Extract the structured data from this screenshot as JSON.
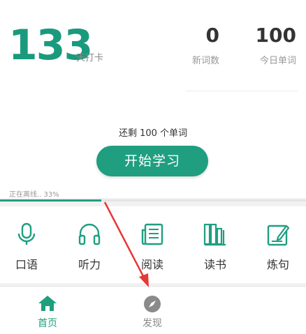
{
  "stats": {
    "days_value": "133",
    "days_label": "天打卡",
    "new_words_value": "0",
    "new_words_label": "新词数",
    "today_words_value": "100",
    "today_words_label": "今日单词"
  },
  "main": {
    "remaining_text": "还剩 100 个单词",
    "start_button": "开始学习"
  },
  "offline": {
    "status_text": "正在离线.. 33%",
    "progress": 0.33
  },
  "tools": [
    {
      "label": "口语",
      "icon": "microphone-icon"
    },
    {
      "label": "听力",
      "icon": "headphones-icon"
    },
    {
      "label": "阅读",
      "icon": "newspaper-icon"
    },
    {
      "label": "读书",
      "icon": "books-icon"
    },
    {
      "label": "炼句",
      "icon": "edit-note-icon"
    }
  ],
  "nav": [
    {
      "label": "首页",
      "icon": "home-icon",
      "active": true
    },
    {
      "label": "发现",
      "icon": "compass-icon",
      "active": false
    }
  ],
  "colors": {
    "accent": "#1f9e80",
    "annotation_arrow": "#e53935"
  }
}
